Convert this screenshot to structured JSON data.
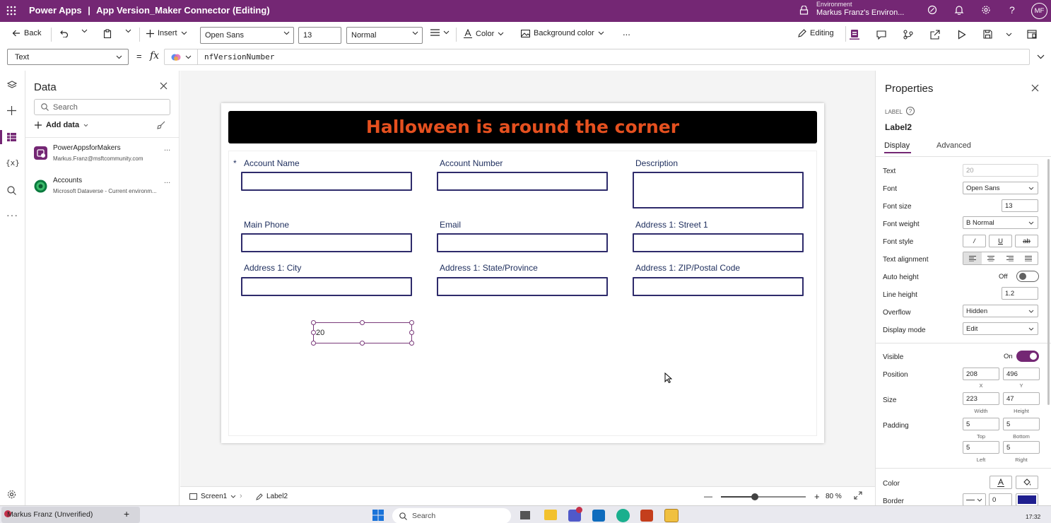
{
  "titlebar": {
    "app_name": "Power Apps",
    "separator": "|",
    "doc_title": "App Version_Maker Connector (Editing)",
    "env_label": "Environment",
    "env_name": "Markus Franz's Environ...",
    "avatar_initials": "MF",
    "bg_color": "#742774"
  },
  "command_bar": {
    "back_label": "Back",
    "insert_label": "Insert",
    "font_value": "Open Sans",
    "font_size_value": "13",
    "weight_value": "Normal",
    "color_label": "Color",
    "bg_color_label": "Background color",
    "more_label": "...",
    "editing_label": "Editing"
  },
  "formula_bar": {
    "property_value": "Text",
    "equals": "=",
    "fx": "fx",
    "formula": "nfVersionNumber"
  },
  "data_panel": {
    "title": "Data",
    "search_placeholder": "Search",
    "add_data_label": "Add data",
    "sources": [
      {
        "name": "PowerAppsforMakers",
        "subtitle": "Markus.Franz@msftcommunity.com",
        "more": "..."
      },
      {
        "name": "Accounts",
        "subtitle": "Microsoft Dataverse - Current environm...",
        "more": "..."
      }
    ]
  },
  "canvas": {
    "banner_text": "Halloween is around the corner",
    "banner_text_color": "#e5501f",
    "required_mark": "*",
    "fields": [
      {
        "label": "Account Name"
      },
      {
        "label": "Account Number"
      },
      {
        "label": "Description"
      },
      {
        "label": "Main Phone"
      },
      {
        "label": "Email"
      },
      {
        "label": "Address 1: Street 1"
      },
      {
        "label": "Address 1: City"
      },
      {
        "label": "Address 1: State/Province"
      },
      {
        "label": "Address 1: ZIP/Postal Code"
      }
    ],
    "selected_label_text": "20"
  },
  "properties": {
    "title": "Properties",
    "control_type": "LABEL",
    "control_name": "Label2",
    "tab_display": "Display",
    "tab_advanced": "Advanced",
    "rows": {
      "text_label": "Text",
      "text_value": "20",
      "font_label": "Font",
      "font_value": "Open Sans",
      "font_size_label": "Font size",
      "font_size_value": "13",
      "font_weight_label": "Font weight",
      "font_weight_value": "B  Normal",
      "font_style_label": "Font style",
      "text_alignment_label": "Text alignment",
      "auto_height_label": "Auto height",
      "auto_height_value": "Off",
      "line_height_label": "Line height",
      "line_height_value": "1.2",
      "overflow_label": "Overflow",
      "overflow_value": "Hidden",
      "display_mode_label": "Display mode",
      "display_mode_value": "Edit",
      "visible_label": "Visible",
      "visible_value": "On",
      "position_label": "Position",
      "position_x": "208",
      "position_y": "496",
      "x_caption": "X",
      "y_caption": "Y",
      "size_label": "Size",
      "size_width": "223",
      "size_height": "47",
      "width_caption": "Width",
      "height_caption": "Height",
      "padding_label": "Padding",
      "padding_top": "5",
      "padding_bottom": "5",
      "padding_left": "5",
      "padding_right": "5",
      "top_caption": "Top",
      "bottom_caption": "Bottom",
      "left_caption": "Left",
      "right_caption": "Right",
      "color_label": "Color",
      "border_label": "Border",
      "border_width": "0",
      "border_color": "#1f1f8f"
    }
  },
  "status_bar": {
    "screen_label": "Screen1",
    "control_label": "Label2",
    "zoom_value": "80 %",
    "zoom_fraction": 0.4
  },
  "taskbar": {
    "profile_label": "Markus Franz (Unverified)",
    "plus": "+",
    "search_label": "Search",
    "clock": "17:32"
  }
}
